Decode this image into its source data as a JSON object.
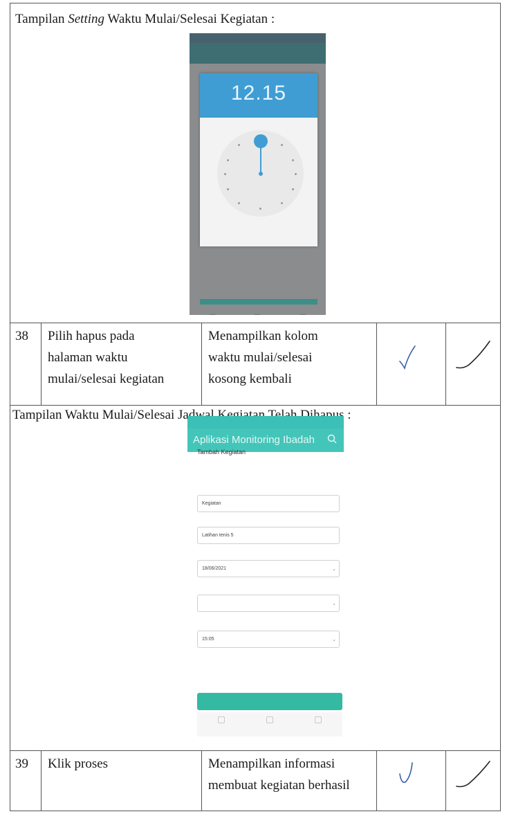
{
  "section1": {
    "caption_prefix": "Tampilan ",
    "caption_italic": "Setting",
    "caption_suffix": " Waktu Mulai/Selesai Kegiatan :",
    "screenshot": {
      "clock_time": "12.15"
    }
  },
  "row38": {
    "number": "38",
    "action_lines": [
      "Pilih hapus pada",
      "halaman waktu",
      "mulai/selesai kegiatan"
    ],
    "expected_lines": [
      "Menampilkan kolom",
      "waktu mulai/selesai",
      "kosong kembali"
    ]
  },
  "section2": {
    "caption": "Tampilan Waktu Mulai/Selesai Jadwal Kegiatan Telah Dihapus :",
    "screenshot": {
      "app_title": "Aplikasi Monitoring Ibadah",
      "form_title": "Tambah Kegiatan",
      "fields": [
        {
          "value": "Kegiatan"
        },
        {
          "value": "Latihan tenis 5"
        },
        {
          "value": "18/06/2021"
        },
        {
          "value": ""
        },
        {
          "value": "15:05"
        }
      ]
    }
  },
  "row39": {
    "number": "39",
    "action_lines": [
      "Klik proses"
    ],
    "expected_lines": [
      "Menampilkan informasi",
      "membuat kegiatan berhasil"
    ]
  },
  "icons": [
    "checkmark-icon",
    "signature-check-icon",
    "search-icon",
    "home-icon",
    "user-icon",
    "calendar-icon"
  ],
  "colors": {
    "picker_header": "#3f9dd3",
    "app_accent": "#44c5b9",
    "button": "#34b9a3"
  }
}
